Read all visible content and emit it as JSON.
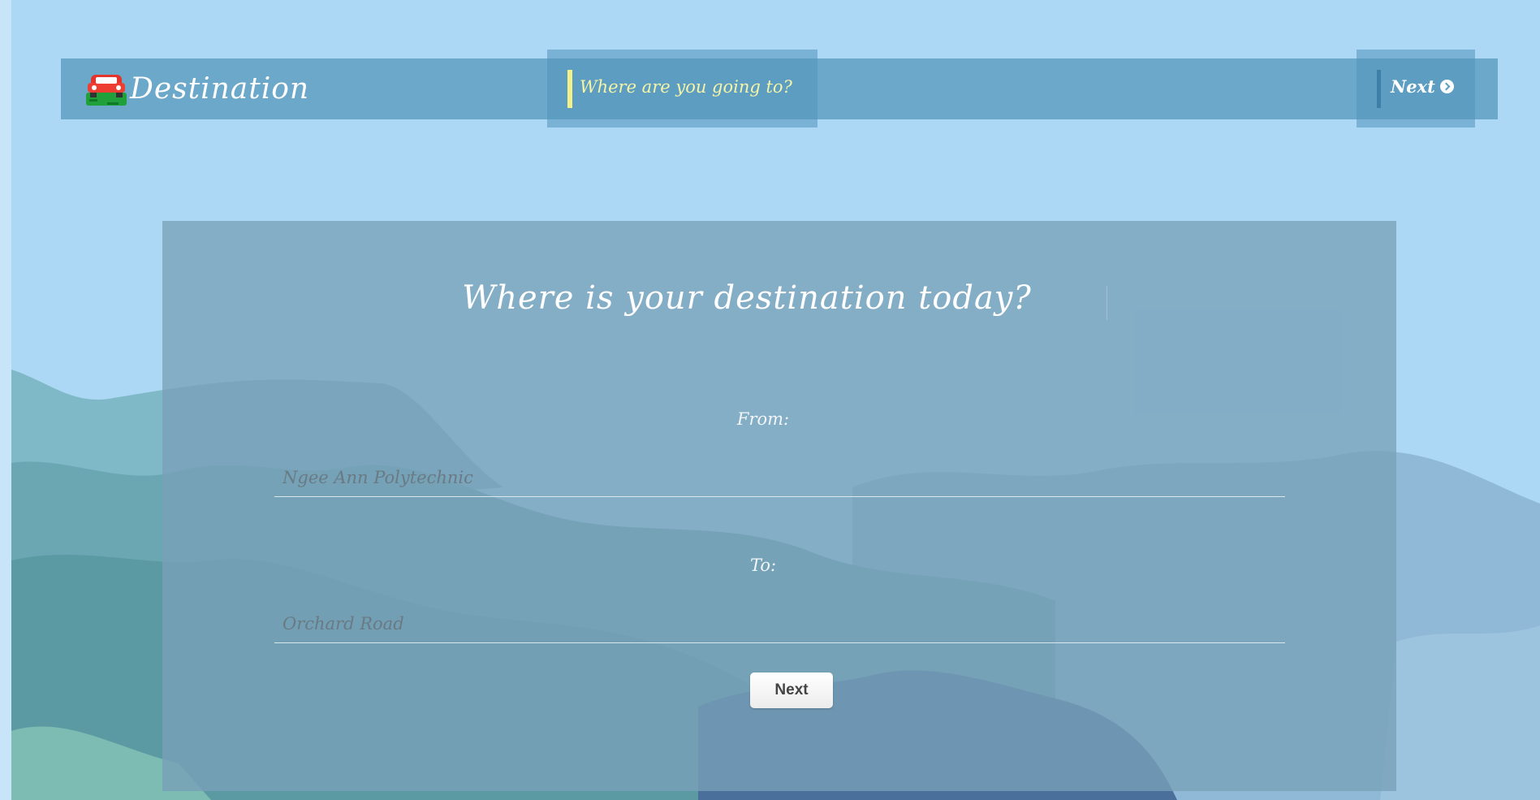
{
  "header": {
    "brand": {
      "icon": "car-icon",
      "title": "Destination"
    },
    "active_step": {
      "label": "Where are you going to?",
      "accent_color": "#f3f08a"
    },
    "next": {
      "label": "Next",
      "icon": "chevron-circle-right-icon"
    }
  },
  "card": {
    "title": "Where is your destination today?",
    "from": {
      "label": "From:",
      "placeholder": "Ngee Ann Polytechnic"
    },
    "to": {
      "label": "To:",
      "placeholder": "Orchard Road"
    },
    "next_button": "Next"
  },
  "colors": {
    "sky": "#acd8f5",
    "navbar": "#5296b9",
    "card": "#78a0b9"
  }
}
